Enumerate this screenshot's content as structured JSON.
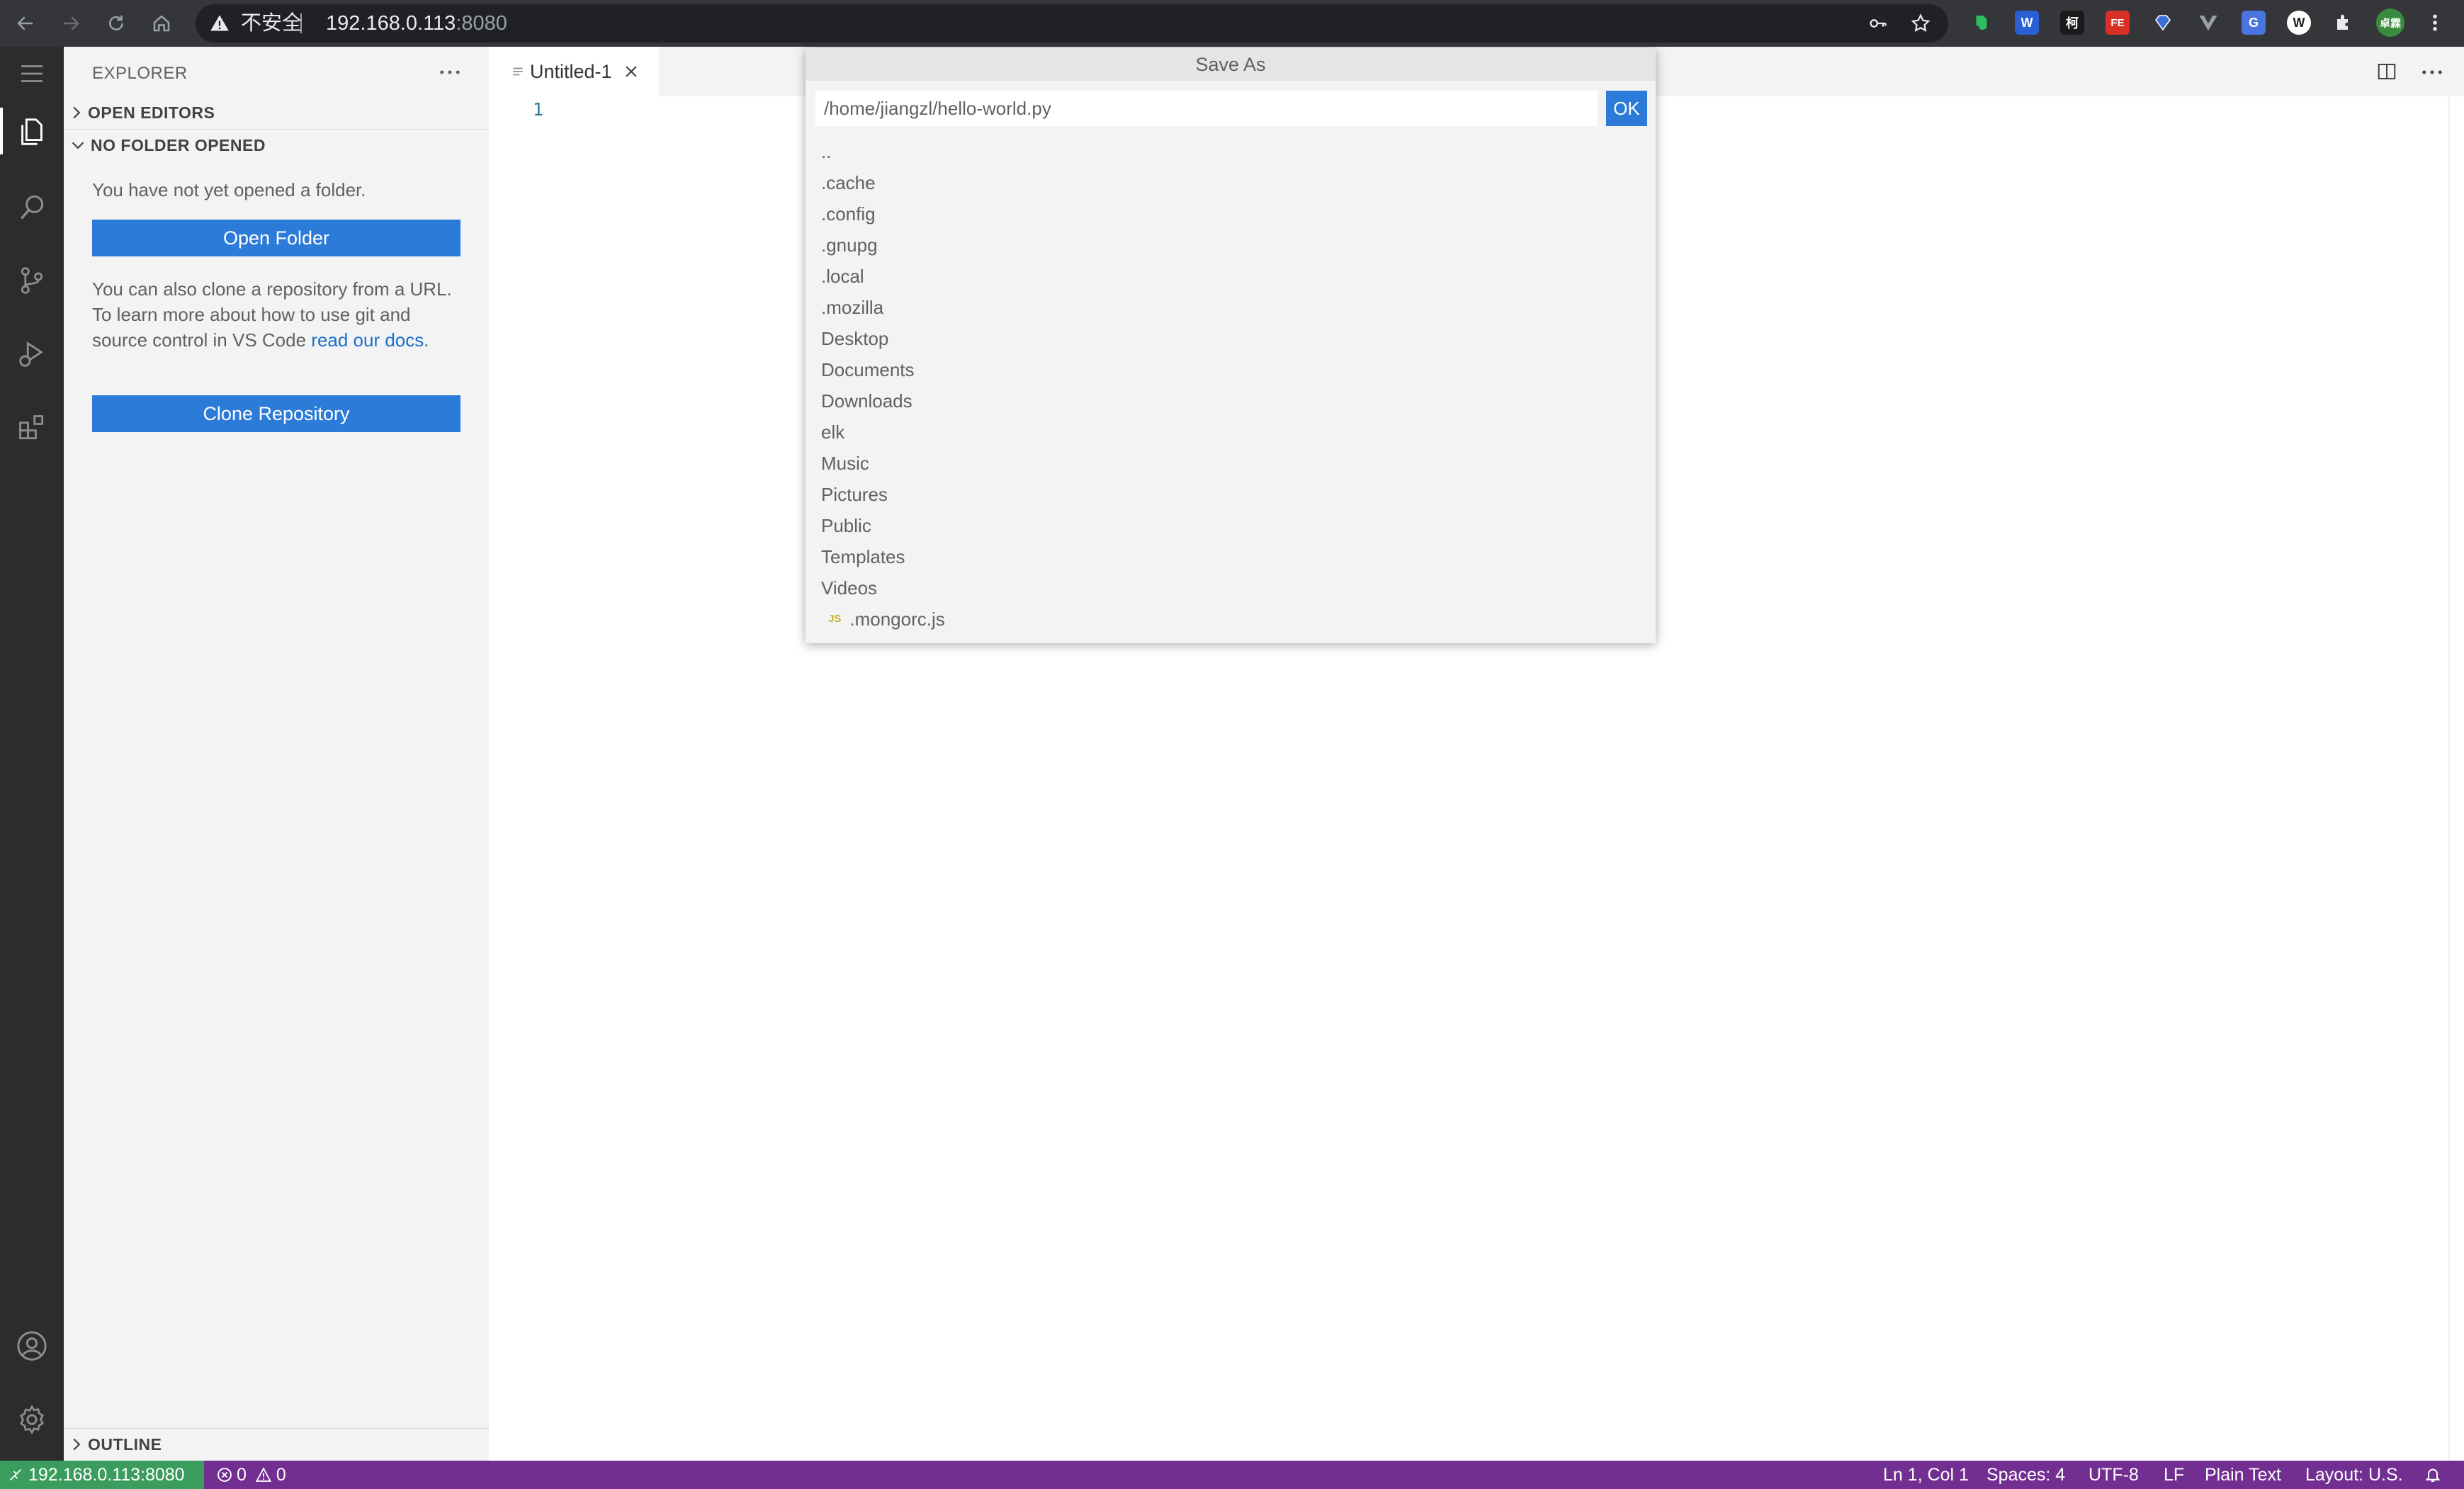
{
  "browser": {
    "security_label": "不安全",
    "host": "192.168.0.113",
    "port": ":8080",
    "extensions": [
      {
        "name": "evernote",
        "letter": "",
        "color": "#2dbe60"
      },
      {
        "name": "word",
        "letter": "W",
        "color": "#2b5fd6"
      },
      {
        "name": "ke",
        "letter": "柯",
        "color": "#1a1a1a"
      },
      {
        "name": "fe",
        "letter": "FE",
        "color": "#d93025"
      },
      {
        "name": "gem",
        "letter": "",
        "color": "#3a6fd8"
      },
      {
        "name": "vue",
        "letter": "V",
        "color": "#5f6368"
      },
      {
        "name": "translate",
        "letter": "G",
        "color": "#4a74e0"
      },
      {
        "name": "wappalyzer",
        "letter": "W",
        "color": "#202124"
      }
    ],
    "profile_initials": "卓霖"
  },
  "sidebar": {
    "title": "EXPLORER",
    "open_editors": "OPEN EDITORS",
    "no_folder": "NO FOLDER OPENED",
    "not_opened_text": "You have not yet opened a folder.",
    "open_folder_button": "Open Folder",
    "clone_text": "You can also clone a repository from a URL. To learn more about how to use git and source control in VS Code ",
    "docs_link": "read our docs",
    "clone_text_end": ".",
    "clone_button": "Clone Repository",
    "outline": "OUTLINE"
  },
  "editor": {
    "tab_label": "Untitled-1",
    "line_number": "1"
  },
  "save_dialog": {
    "title": "Save As",
    "path_value": "/home/jiangzl/hello-world.py",
    "ok_label": "OK",
    "entries": [
      "..",
      ".cache",
      ".config",
      ".gnupg",
      ".local",
      ".mozilla",
      "Desktop",
      "Documents",
      "Downloads",
      "elk",
      "Music",
      "Pictures",
      "Public",
      "Templates",
      "Videos"
    ],
    "js_file": {
      "badge": "JS",
      "name": ".mongorc.js"
    }
  },
  "status_bar": {
    "remote": "192.168.0.113:8080",
    "errors": "0",
    "warnings": "0",
    "position": "Ln 1, Col 1",
    "spaces": "Spaces: 4",
    "encoding": "UTF-8",
    "eol": "LF",
    "language": "Plain Text",
    "layout": "Layout: U.S."
  },
  "colors": {
    "accent": "#2c7bd8",
    "status_bar": "#722f91",
    "remote_indicator": "#3a9d5d",
    "activity_bar": "#2c2c2c"
  }
}
